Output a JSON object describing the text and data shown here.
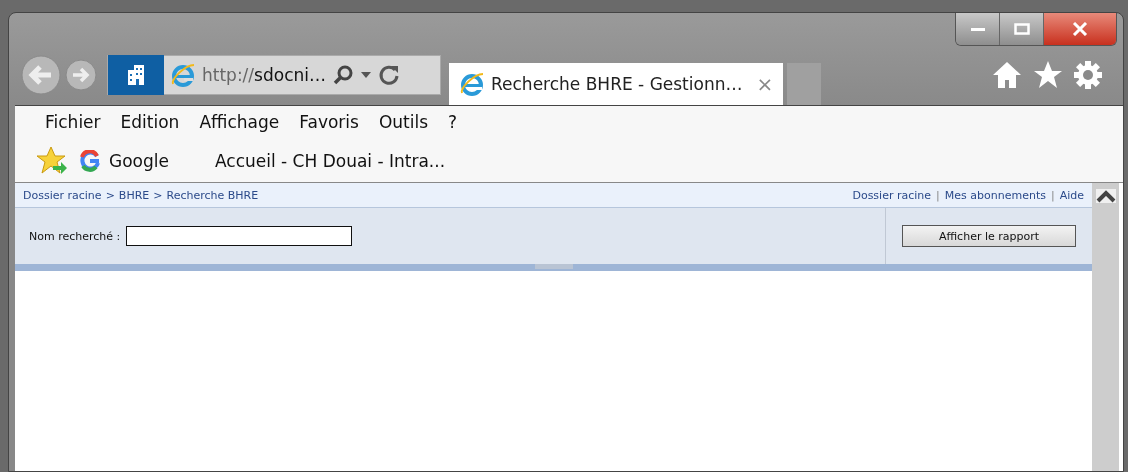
{
  "address": {
    "scheme": "http://",
    "host": "sdocni…"
  },
  "tabs": [
    {
      "title": "Recherche BHRE - Gestionn…",
      "close": "×",
      "selected": true
    }
  ],
  "menu": [
    "Fichier",
    "Edition",
    "Affichage",
    "Favoris",
    "Outils",
    "?"
  ],
  "favorites": [
    {
      "label": "Google",
      "kind": "google"
    },
    {
      "label": "Accueil - CH Douai - Intra...",
      "kind": "page"
    }
  ],
  "breadcrumb": {
    "separator": ">",
    "items": [
      "Dossier racine",
      "BHRE",
      "Recherche BHRE"
    ]
  },
  "top_links": {
    "divider": "|",
    "items": [
      "Dossier racine",
      "Mes abonnements",
      "Aide"
    ]
  },
  "parameters": {
    "label": "Nom recherché :",
    "button": "Afficher le rapport"
  }
}
